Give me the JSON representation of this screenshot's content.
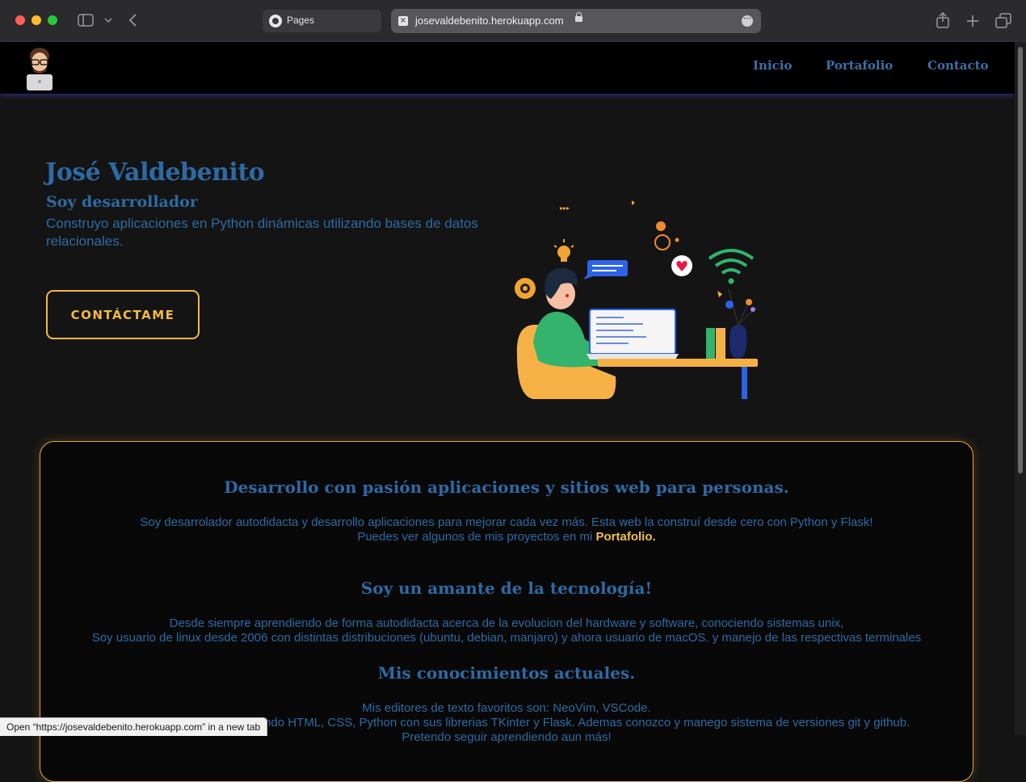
{
  "browser": {
    "tab_label": "Pages",
    "url": "josevaldebenito.herokuapp.com",
    "status_tooltip": "Open “https://josevaldebenito.herokuapp.com” in a new tab"
  },
  "nav": {
    "items": [
      "Inicio",
      "Portafolio",
      "Contacto"
    ]
  },
  "hero": {
    "name": "José Valdebenito",
    "subtitle": "Soy desarrollador",
    "description": "Construyo aplicaciones en Python dinámicas utilizando bases de datos relacionales.",
    "cta_label": "CONTÁCTAME"
  },
  "about": {
    "heading1": "Desarrollo con pasión aplicaciones y sitios web para personas.",
    "para1_line1": "Soy desarrolador autodidacta y desarrollo aplicaciones para mejorar cada vez más. Esta web la construí desde cero con Python y Flask!",
    "para1_line2_prefix": "Puedes ver algunos de mis proyectos en mi",
    "para1_link": "Portafolio.",
    "heading2": "Soy un amante de la tecnología!",
    "para2_line1": "Desde siempre aprendiendo de forma autodidacta acerca de la evolucion del hardware y software, conociendo sistemas unix,",
    "para2_line2": "Soy usuario de linux desde 2006 con distintas distribuciones (ubuntu, debian, manjaro) y ahora usuario de macOS. y manejo de las respectivas terminales",
    "heading3": "Mis conocimientos actuales.",
    "para3_line1": "Mis editores de texto favoritos son: NeoVim, VSCode.",
    "para3_line2": "Desarrollo páginas web utilizando HTML, CSS, Python con sus librerias TKinter y Flask. Ademas conozco y manego sistema de versiones git y github.",
    "para3_line3": "Pretendo seguir aprendiendo aun más!"
  }
}
